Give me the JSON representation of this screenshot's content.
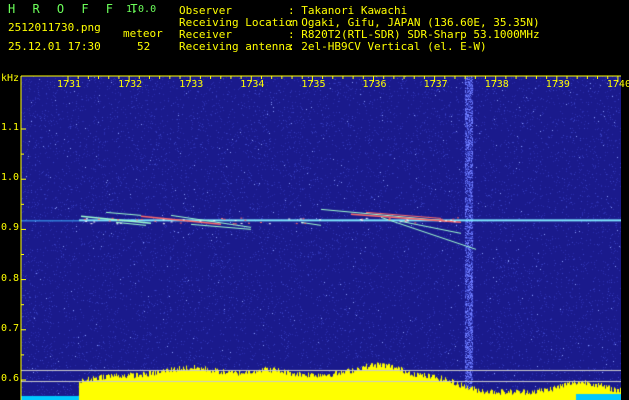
{
  "header": {
    "logo": "H R O F F T",
    "version": "1.0.0",
    "filename": "2512011730.png",
    "datetime": "25.12.01 17:30",
    "meteor_label": "meteor",
    "meteor_count": "52",
    "observer_label": "Observer",
    "observer_value": ": Takanori Kawachi",
    "location_label": "Receiving Location",
    "location_value": ": Ogaki, Gifu, JAPAN (136.60E, 35.35N)",
    "receiver_label": "Receiver",
    "receiver_value": ": R820T2(RTL-SDR) SDR-Sharp 53.1000MHz",
    "antenna_label": "Receiving antenna",
    "antenna_value": ": 2el-HB9CV Vertical (el. E-W)"
  },
  "chart_data": {
    "type": "heatmap",
    "ylabel": "kHz",
    "ylim": [
      0.58,
      1.2
    ],
    "yticks": [
      "1.1",
      "1.0",
      "0.9",
      "0.8",
      "0.7",
      "0.6"
    ],
    "xticks": [
      "1731",
      "1732",
      "1733",
      "1734",
      "1735",
      "1736",
      "1737",
      "1738",
      "1739",
      "1740"
    ],
    "carrier_khz": 0.92,
    "colors": {
      "background": "#1a1a8c",
      "noise": "#3c46c8",
      "carrier": "#7fe6ff",
      "echo_hot": "#ff6a6a",
      "echo_cool": "#9fffd0",
      "tick": "#ffff00",
      "level_bar": "#ffff00",
      "base_bar": "#00c8ff"
    }
  }
}
